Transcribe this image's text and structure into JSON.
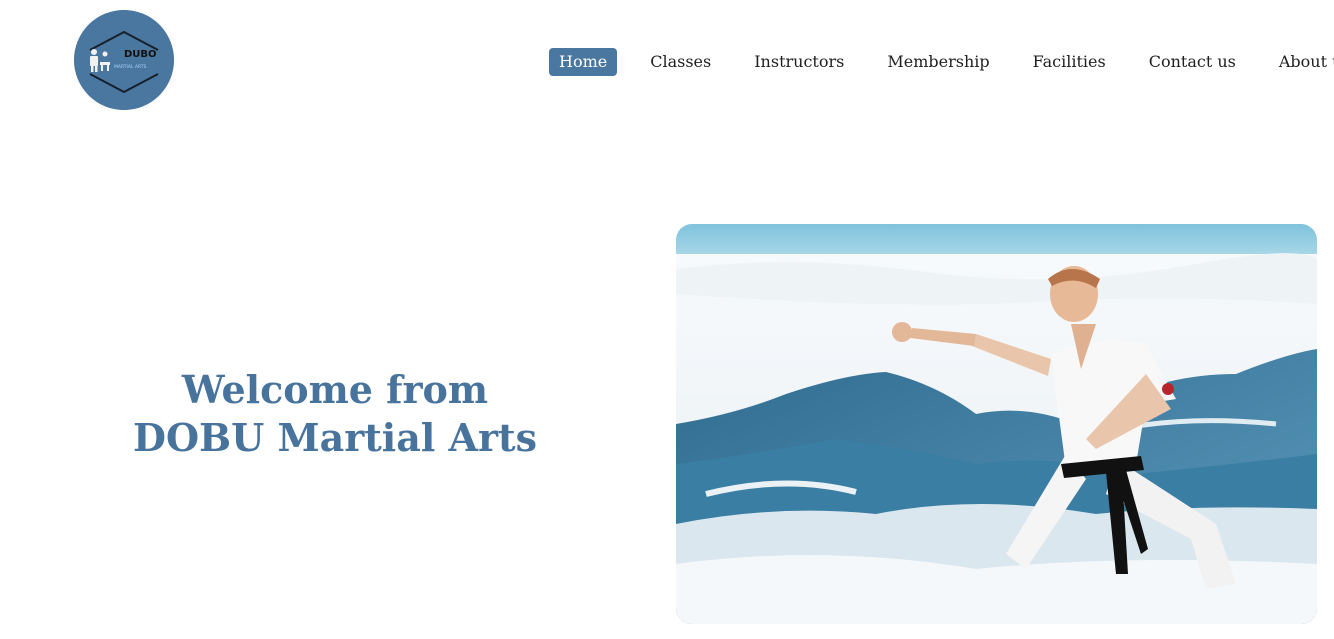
{
  "logo": {
    "text": "DUBO",
    "subtext": "MARTIAL ARTS",
    "colors": {
      "circle": "#4a77a0"
    }
  },
  "nav": {
    "items": [
      {
        "label": "Home",
        "active": true
      },
      {
        "label": "Classes",
        "active": false
      },
      {
        "label": "Instructors",
        "active": false
      },
      {
        "label": "Membership",
        "active": false
      },
      {
        "label": "Facilities",
        "active": false
      },
      {
        "label": "Contact us",
        "active": false
      },
      {
        "label": "About us",
        "active": false
      }
    ],
    "colors": {
      "active_bg": "#4a77a0",
      "active_text": "#ffffff",
      "text": "#1f1f1f"
    }
  },
  "hero": {
    "title_line1": "Welcome from",
    "title_line2": "DOBU Martial Arts",
    "title_color": "#47739c",
    "image_subject": "karate practitioner in white gi with black belt on snowy mountain"
  }
}
